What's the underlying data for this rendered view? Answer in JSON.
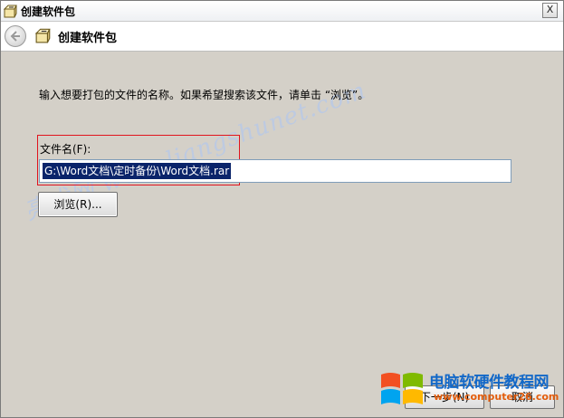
{
  "window": {
    "title": "创建软件包",
    "close_glyph": "X"
  },
  "header": {
    "title": "创建软件包"
  },
  "content": {
    "instruction": "输入想要打包的文件的名称。如果希望搜索该文件，请单击 “浏览”。",
    "field_label": "文件名(F):",
    "file_value": "G:\\Word文档\\定时备份\\Word文档.rar",
    "browse_label": "浏览(R)..."
  },
  "footer": {
    "next_label": "下一步(N)",
    "cancel_label": "取消"
  },
  "watermark": {
    "text": "亮术网 www.liangshunet.com"
  },
  "logo": {
    "title": "电脑软硬件教程网",
    "url": "www.computer26.com"
  },
  "colors": {
    "highlight_border": "#e0141e",
    "selection_bg": "#0a246a",
    "logo_blue": "#1268c8",
    "logo_orange": "#e35d0c"
  },
  "icons": [
    "package-icon",
    "back-arrow-icon",
    "close-icon",
    "windows-logo-icon"
  ]
}
